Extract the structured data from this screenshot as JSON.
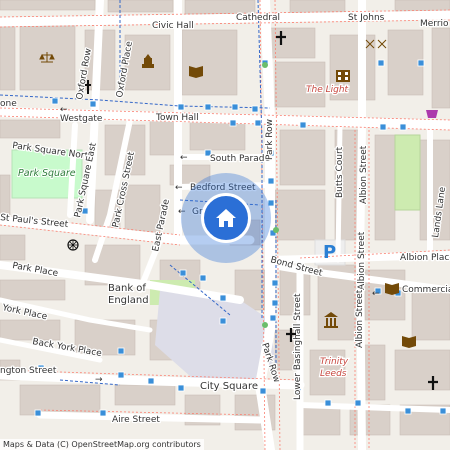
{
  "map": {
    "attribution": {
      "prefix": "Maps & Data (C)",
      "link": "OpenStreetMap.org contributors"
    },
    "accent_color": "#2b6fd6",
    "streets": [
      {
        "id": "civic-hall",
        "text": "Civic Hall"
      },
      {
        "id": "cathedral",
        "text": "Cathedral"
      },
      {
        "id": "st-johns",
        "text": "St Johns"
      },
      {
        "id": "merrion",
        "text": "Merrio"
      },
      {
        "id": "oxford-row",
        "text": "Oxford Row"
      },
      {
        "id": "oxford-place",
        "text": "Oxford Place"
      },
      {
        "id": "westgate",
        "text": "Westgate"
      },
      {
        "id": "town-hall",
        "text": "Town Hall"
      },
      {
        "id": "park-square-north",
        "text": "Park Square North"
      },
      {
        "id": "park-square-east",
        "text": "Park Square East"
      },
      {
        "id": "park-cross-street",
        "text": "Park Cross Street"
      },
      {
        "id": "south-parade",
        "text": "South Parade"
      },
      {
        "id": "bedford-street",
        "text": "Bedford Street"
      },
      {
        "id": "park-row",
        "text": "Park Row"
      },
      {
        "id": "st-pauls-street",
        "text": "St Paul's Street"
      },
      {
        "id": "east-parade",
        "text": "East Parade"
      },
      {
        "id": "gr",
        "text": "Gr"
      },
      {
        "id": "park-place",
        "text": "Park Place"
      },
      {
        "id": "bank-of-england-1",
        "text": "Bank of"
      },
      {
        "id": "bank-of-england-2",
        "text": "England"
      },
      {
        "id": "york-place",
        "text": "York Place"
      },
      {
        "id": "back-york-place",
        "text": "Back York Place"
      },
      {
        "id": "wellington-street",
        "text": "ngton Street"
      },
      {
        "id": "city-square",
        "text": "City Square"
      },
      {
        "id": "aire-street",
        "text": "Aire Street"
      },
      {
        "id": "bond-street",
        "text": "Bond Street"
      },
      {
        "id": "butts-court",
        "text": "Butts Court"
      },
      {
        "id": "albion-street",
        "text": "Albion Street"
      },
      {
        "id": "albion-street-2",
        "text": "Albion Street"
      },
      {
        "id": "albion-street-3",
        "text": "Albion Street"
      },
      {
        "id": "albion-place",
        "text": "Albion Place"
      },
      {
        "id": "lands-lane",
        "text": "Lands Lane"
      },
      {
        "id": "commercial",
        "text": "Commercial"
      },
      {
        "id": "lower-basinghall",
        "text": "Lower Basinghall Street"
      },
      {
        "id": "park-row-2",
        "text": "Park Row"
      },
      {
        "id": "one",
        "text": "one"
      }
    ],
    "parks": [
      {
        "id": "park-square",
        "text": "Park Square"
      }
    ],
    "pois": [
      {
        "id": "the-light",
        "text": "The Light"
      },
      {
        "id": "trinity",
        "text": "Trinity"
      },
      {
        "id": "leeds",
        "text": "Leeds"
      }
    ],
    "icons": [
      "church-icon",
      "courthouse-icon",
      "library-icon",
      "cinema-icon",
      "shopping-icon",
      "parking-icon",
      "museum-icon",
      "home-icon",
      "bus-stop-icon"
    ],
    "location_marker": {
      "icon": "home-icon"
    }
  }
}
